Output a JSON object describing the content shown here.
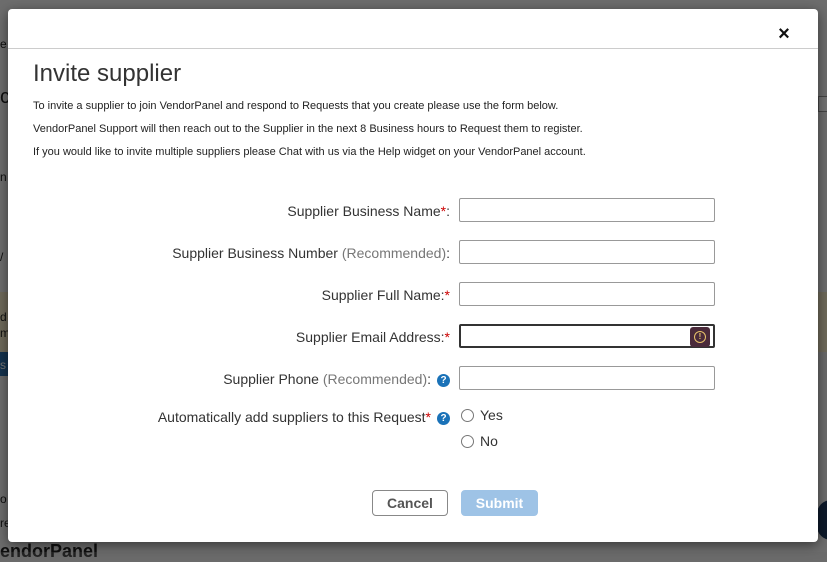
{
  "modal": {
    "title": "Invite supplier",
    "close_glyph": "×",
    "intro_lines": [
      "To invite a supplier to join VendorPanel and respond to Requests that you create please use the form below.",
      "VendorPanel Support will then reach out to the Supplier in the next 8 Business hours to Request them to register.",
      "If you would like to invite multiple suppliers please Chat with us via the Help widget on your VendorPanel account."
    ]
  },
  "form": {
    "business_name": {
      "label": "Supplier Business Name",
      "required_mark": "*",
      "suffix": ":",
      "value": ""
    },
    "business_number": {
      "label": "Supplier Business Number",
      "note": "(Recommended)",
      "suffix": ":",
      "value": ""
    },
    "full_name": {
      "label": "Supplier Full Name:",
      "required_mark": "*",
      "value": ""
    },
    "email": {
      "label": "Supplier Email Address:",
      "required_mark": "*",
      "value": ""
    },
    "phone": {
      "label": "Supplier Phone",
      "note": "(Recommended)",
      "suffix": ":",
      "value": "",
      "help_glyph": "?"
    },
    "auto_add": {
      "label": "Automatically add suppliers to this Request",
      "required_mark": "*",
      "help_glyph": "?",
      "options": [
        "Yes",
        "No"
      ]
    }
  },
  "buttons": {
    "cancel": "Cancel",
    "submit": "Submit"
  },
  "background": {
    "fragments": [
      "e",
      "ch",
      "n",
      "/",
      "d",
      "m",
      "s",
      "o",
      "re",
      "endorPanel"
    ]
  },
  "colors": {
    "required": "#cc0000",
    "help_icon": "#1a72b8",
    "submit_disabled": "#9ec3e6"
  }
}
